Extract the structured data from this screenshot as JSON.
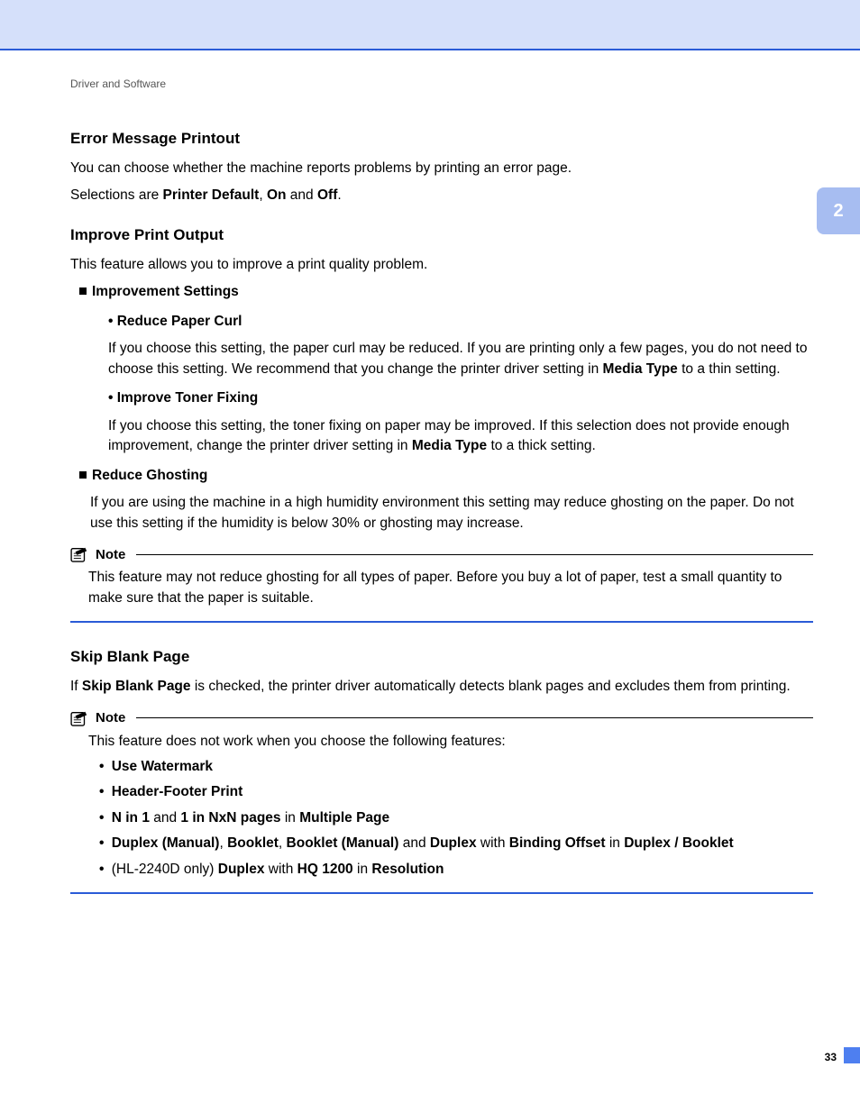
{
  "breadcrumb": "Driver and Software",
  "chapter_tab": "2",
  "page_number": "33",
  "sec1": {
    "title": "Error Message Printout",
    "p1": "You can choose whether the machine reports problems by printing an error page.",
    "p2a": "Selections are ",
    "p2b": "Printer Default",
    "p2c": ", ",
    "p2d": "On",
    "p2e": " and ",
    "p2f": "Off",
    "p2g": "."
  },
  "sec2": {
    "title": "Improve Print Output",
    "p1": "This feature allows you to improve a print quality problem.",
    "b1": "Improvement Settings",
    "b1a_title": "Reduce Paper Curl",
    "b1a_t1": "If you choose this setting, the paper curl may be reduced. If you are printing only a few pages, you do not need to choose this setting. We recommend that you change the printer driver setting in ",
    "b1a_t2": "Media Type",
    "b1a_t3": " to a thin setting.",
    "b1b_title": "Improve Toner Fixing",
    "b1b_t1": "If you choose this setting, the toner fixing on paper may be improved. If this selection does not provide enough improvement, change the printer driver setting in ",
    "b1b_t2": "Media Type",
    "b1b_t3": " to a thick setting.",
    "b2": "Reduce Ghosting",
    "b2_t": "If you are using the machine in a high humidity environment this setting may reduce ghosting on the paper. Do not use this setting if the humidity is below 30% or ghosting may increase."
  },
  "note1": {
    "label": "Note",
    "body": "This feature may not reduce ghosting for all types of paper. Before you buy a lot of paper, test a small quantity to make sure that the paper is suitable."
  },
  "sec3": {
    "title": "Skip Blank Page",
    "p1a": "If ",
    "p1b": "Skip Blank Page",
    "p1c": " is checked, the printer driver automatically detects blank pages and excludes them from printing."
  },
  "note2": {
    "label": "Note",
    "intro": "This feature does not work when you choose the following features:",
    "li1": "Use Watermark",
    "li2": "Header-Footer Print",
    "li3a": "N in 1",
    "li3b": " and ",
    "li3c": "1 in NxN pages",
    "li3d": " in ",
    "li3e": "Multiple Page",
    "li4a": "Duplex (Manual)",
    "li4b": ", ",
    "li4c": "Booklet",
    "li4d": ", ",
    "li4e": "Booklet (Manual)",
    "li4f": " and ",
    "li4g": "Duplex",
    "li4h": " with ",
    "li4i": "Binding Offset",
    "li4j": " in ",
    "li4k": "Duplex / Booklet",
    "li5a": "(HL-2240D only) ",
    "li5b": "Duplex",
    "li5c": " with ",
    "li5d": "HQ 1200",
    "li5e": " in ",
    "li5f": "Resolution"
  }
}
